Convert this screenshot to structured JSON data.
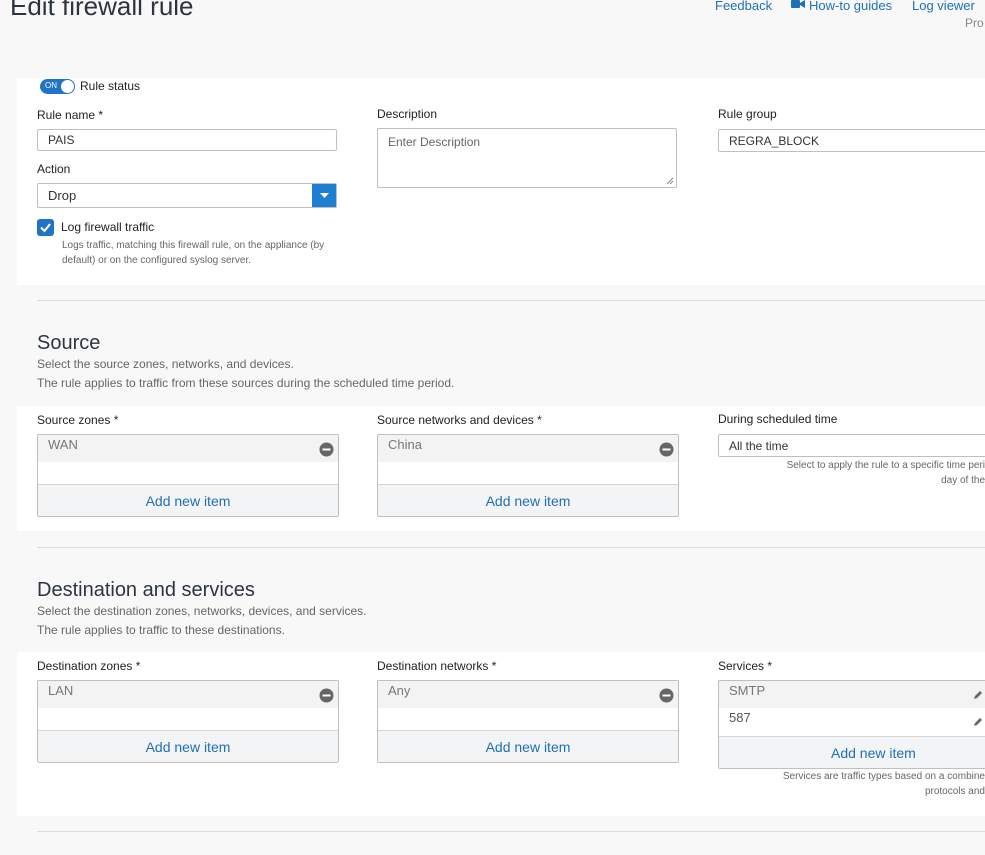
{
  "page": {
    "title": "Edit firewall rule",
    "links": {
      "feedback": "Feedback",
      "howto": "How-to guides",
      "logviewer": "Log viewer"
    },
    "pro_partial": "Pro"
  },
  "rule": {
    "status_label": "Rule status",
    "status_toggle": "ON",
    "name_label": "Rule name *",
    "name_value": "PAIS",
    "description_label": "Description",
    "description_placeholder": "Enter Description",
    "group_label": "Rule group",
    "group_value": "REGRA_BLOCK",
    "action_label": "Action",
    "action_value": "Drop",
    "log_label": "Log firewall traffic",
    "log_checked": true,
    "log_help_line1": "Logs traffic, matching this firewall rule, on the appliance (by",
    "log_help_line2": "default) or on the configured syslog server."
  },
  "source": {
    "title": "Source",
    "desc1": "Select the source zones, networks, and devices.",
    "desc2": "The rule applies to traffic from these sources during the scheduled time period.",
    "zones_label": "Source zones *",
    "zones": [
      "WAN"
    ],
    "networks_label": "Source networks and devices *",
    "networks": [
      "China"
    ],
    "add_item": "Add new item",
    "schedule_label": "During scheduled time",
    "schedule_value": "All the time",
    "schedule_help1": "Select to apply the rule to a specific time peri",
    "schedule_help2": "day of the"
  },
  "destination": {
    "title": "Destination and services",
    "desc1": "Select the destination zones, networks, devices, and services.",
    "desc2": "The rule applies to traffic to these destinations.",
    "zones_label": "Destination zones *",
    "zones": [
      "LAN"
    ],
    "networks_label": "Destination networks *",
    "networks": [
      "Any"
    ],
    "services_label": "Services *",
    "services": [
      "SMTP",
      "587"
    ],
    "add_item": "Add new item",
    "services_help1": "Services are traffic types based on a combine",
    "services_help2": "protocols and"
  },
  "colors": {
    "accent": "#1f74c8",
    "link": "#1f6fb5",
    "panel": "#ffffff",
    "background": "#f8f8f9"
  }
}
